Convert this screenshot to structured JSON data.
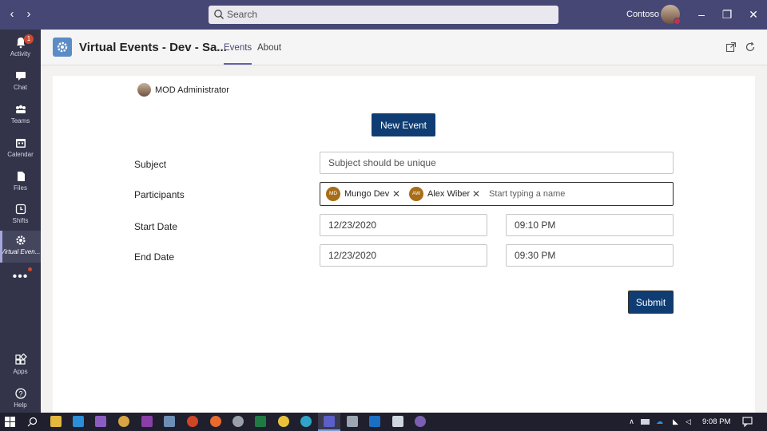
{
  "titlebar": {
    "search_placeholder": "Search",
    "tenant": "Contoso"
  },
  "rail": {
    "items": [
      {
        "label": "Activity",
        "icon": "bell-icon",
        "badge": "1"
      },
      {
        "label": "Chat",
        "icon": "chat-icon"
      },
      {
        "label": "Teams",
        "icon": "teams-icon"
      },
      {
        "label": "Calendar",
        "icon": "calendar-icon"
      },
      {
        "label": "Files",
        "icon": "file-icon"
      },
      {
        "label": "Shifts",
        "icon": "clock-icon"
      },
      {
        "label": "Virtual Even...",
        "icon": "gear-icon"
      },
      {
        "label": "Apps",
        "icon": "apps-icon"
      },
      {
        "label": "Help",
        "icon": "help-icon"
      }
    ]
  },
  "header": {
    "app_title": "Virtual Events - Dev - Sa...",
    "tabs": [
      {
        "label": "Events",
        "active": true
      },
      {
        "label": "About",
        "active": false
      }
    ]
  },
  "form": {
    "user_name": "MOD Administrator",
    "new_event_label": "New Event",
    "subject_label": "Subject",
    "subject_placeholder": "Subject should be unique",
    "participants_label": "Participants",
    "participants": [
      {
        "initials": "MD",
        "name": "Mungo Dev"
      },
      {
        "initials": "AW",
        "name": "Alex Wiber"
      }
    ],
    "participants_placeholder": "Start typing a name",
    "start_date_label": "Start Date",
    "start_date": "12/23/2020",
    "start_time": "09:10 PM",
    "end_date_label": "End Date",
    "end_date": "12/23/2020",
    "end_time": "09:30 PM",
    "submit_label": "Submit"
  },
  "taskbar": {
    "clock": "9:08 PM"
  },
  "colors": {
    "titlebar": "#464775",
    "rail": "#33344a",
    "primary_button": "#0f3d73",
    "accent": "#6264a7"
  }
}
